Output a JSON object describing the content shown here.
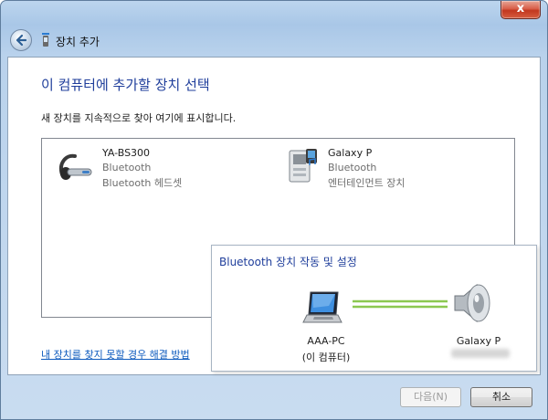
{
  "window": {
    "title": "장치 추가",
    "close_label": "x"
  },
  "main": {
    "heading": "이 컴퓨터에 추가할 장치 선택",
    "subtext": "새 장치를 지속적으로 찾아 여기에 표시합니다.",
    "devices": [
      {
        "name": "YA-BS300",
        "type": "Bluetooth",
        "category": "Bluetooth 헤드셋",
        "icon": "headset-icon"
      },
      {
        "name": "Galaxy P",
        "type": "Bluetooth",
        "category": "엔터테인먼트 장치",
        "icon": "media-device-icon"
      }
    ],
    "help_link": "내 장치를 찾지 못할 경우 해결 방법"
  },
  "popup": {
    "title": "Bluetooth 장치 작동 및 설정",
    "pc_name": "AAA-PC",
    "pc_subtitle": "(이 컴퓨터)",
    "device_name": "Galaxy P",
    "line_color": "#8cc850"
  },
  "buttons": {
    "next": "다음(N)",
    "cancel": "취소"
  },
  "colors": {
    "heading": "#1f3e9b",
    "link": "#0e5bbe",
    "close": "#c2371f"
  }
}
